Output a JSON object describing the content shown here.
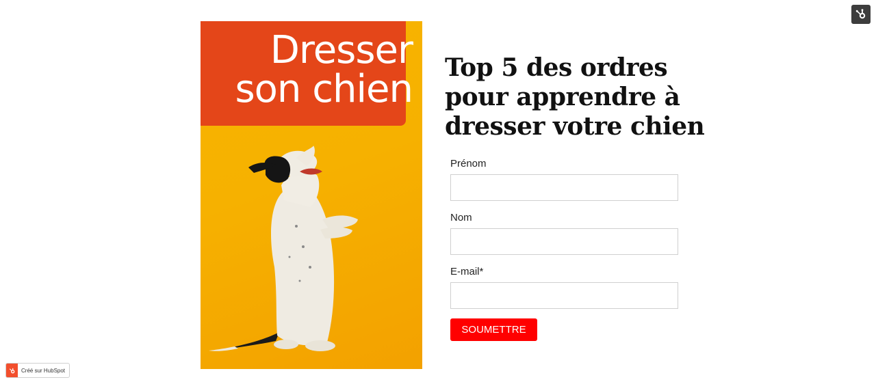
{
  "cover": {
    "title_line1": "Dresser",
    "title_line2": "son chien",
    "banner_color": "#e44619",
    "background_color": "#f8b400",
    "image": "dog-sitting-up-photo"
  },
  "headline": "Top 5 des ordres pour apprendre à dresser votre chien",
  "form": {
    "first_name_label": "Prénom",
    "first_name_value": "",
    "last_name_label": "Nom",
    "last_name_value": "",
    "email_label": "E-mail*",
    "email_value": "",
    "submit_label": "SOUMETTRE",
    "submit_color": "#ff0000"
  },
  "corner_icon": "hubspot-icon",
  "badge": {
    "icon": "hubspot-icon",
    "text": "Créé sur HubSpot"
  }
}
